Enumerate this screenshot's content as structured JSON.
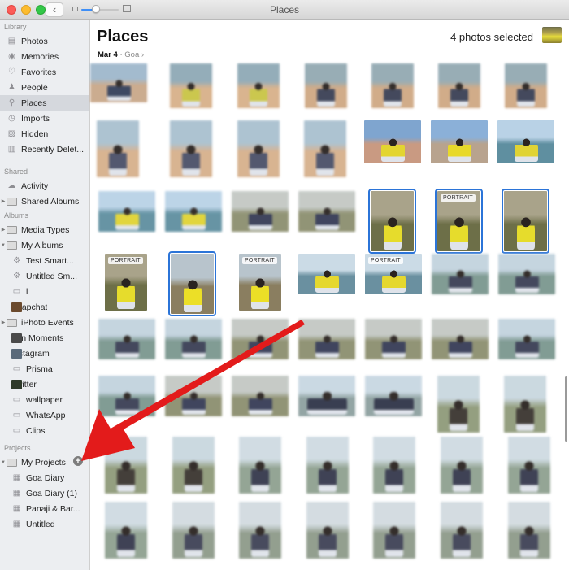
{
  "window": {
    "title": "Places",
    "back_glyph": "‹",
    "zoom_slider_value": 0.4
  },
  "sidebar": {
    "sections": [
      {
        "heading": "Library",
        "items": [
          {
            "label": "Photos",
            "icon": "photos-icon"
          },
          {
            "label": "Memories",
            "icon": "memories-icon"
          },
          {
            "label": "Favorites",
            "icon": "heart-icon"
          },
          {
            "label": "People",
            "icon": "person-icon"
          },
          {
            "label": "Places",
            "icon": "pin-icon",
            "selected": true
          },
          {
            "label": "Imports",
            "icon": "clock-icon"
          },
          {
            "label": "Hidden",
            "icon": "hidden-icon"
          },
          {
            "label": "Recently Delet...",
            "icon": "trash-icon"
          }
        ]
      },
      {
        "heading": "Shared",
        "items": [
          {
            "label": "Activity",
            "icon": "cloud-icon"
          },
          {
            "label": "Shared Albums",
            "icon": "folder-icon",
            "disclosure": "collapsed"
          }
        ]
      },
      {
        "heading": "Albums",
        "items": [
          {
            "label": "Media Types",
            "icon": "folder-icon",
            "disclosure": "collapsed"
          },
          {
            "label": "My Albums",
            "icon": "folder-icon",
            "disclosure": "expanded"
          },
          {
            "label": "Test Smart...",
            "icon": "smart-album-icon"
          },
          {
            "label": "Untitled Sm...",
            "icon": "smart-album-icon"
          },
          {
            "label": "l",
            "icon": "album-icon"
          },
          {
            "label": "Snapchat",
            "icon": "album-thumb-icon"
          },
          {
            "label": "iPhoto Events",
            "icon": "folder-icon",
            "disclosure": "collapsed"
          },
          {
            "label": "Fun Moments",
            "icon": "album-thumb-icon"
          },
          {
            "label": "Instagram",
            "icon": "album-thumb-icon"
          },
          {
            "label": "Prisma",
            "icon": "album-icon"
          },
          {
            "label": "Twitter",
            "icon": "album-thumb-icon"
          },
          {
            "label": "wallpaper",
            "icon": "album-icon"
          },
          {
            "label": "WhatsApp",
            "icon": "album-icon"
          },
          {
            "label": "Clips",
            "icon": "album-icon"
          }
        ]
      },
      {
        "heading": "Projects",
        "items": [
          {
            "label": "My Projects",
            "icon": "folder-icon",
            "disclosure": "expanded"
          },
          {
            "label": "Goa Diary",
            "icon": "project-icon"
          },
          {
            "label": "Goa Diary (1)",
            "icon": "project-icon"
          },
          {
            "label": "Panaji & Bar...",
            "icon": "project-icon"
          },
          {
            "label": "Untitled",
            "icon": "project-icon"
          }
        ]
      }
    ],
    "add_button_glyph": "+"
  },
  "main": {
    "title": "Places",
    "selected_count_label": "4 photos selected",
    "date": "Mar 4",
    "separator": "·",
    "place": "Goa",
    "place_chevron": "›",
    "portrait_badge": "PORTRAIT",
    "grid_rows": [
      [
        {
          "kind": "beach-selfie",
          "blur": true
        },
        {
          "kind": "beach-yellow",
          "blur": true
        },
        {
          "kind": "beach-yellow",
          "blur": true
        },
        {
          "kind": "beach-dark",
          "blur": true
        },
        {
          "kind": "beach-dark",
          "blur": true
        },
        {
          "kind": "beach-dark",
          "blur": true
        },
        {
          "kind": "beach-dark",
          "blur": true
        }
      ],
      [
        {
          "kind": "beach-tall",
          "blur": true
        },
        {
          "kind": "beach-tall",
          "blur": true
        },
        {
          "kind": "beach-tall",
          "blur": true
        },
        {
          "kind": "beach-tall",
          "blur": true
        },
        {
          "kind": "promenade-yellow"
        },
        {
          "kind": "selfie-yellow"
        },
        {
          "kind": "sea-yellow"
        }
      ],
      [
        {
          "kind": "sea-yellow",
          "blur": true
        },
        {
          "kind": "sea-yellow",
          "blur": true
        },
        {
          "kind": "grass-dark",
          "blur": true
        },
        {
          "kind": "grass-dark",
          "blur": true
        },
        {
          "kind": "sit-yellow",
          "selected": true
        },
        {
          "kind": "sit-yellow",
          "selected": true,
          "portrait": true
        },
        {
          "kind": "sit-yellow",
          "selected": true
        }
      ],
      [
        {
          "kind": "sit-yellow",
          "portrait": true
        },
        {
          "kind": "sit-closeup",
          "selected": true
        },
        {
          "kind": "sit-closeup",
          "portrait": true
        },
        {
          "kind": "sea-back-yellow"
        },
        {
          "kind": "sea-back-yellow",
          "portrait": true
        },
        {
          "kind": "sea-dark",
          "blur": true
        },
        {
          "kind": "sea-dark",
          "blur": true
        }
      ],
      [
        {
          "kind": "sea-dark",
          "blur": true
        },
        {
          "kind": "sea-dark",
          "blur": true
        },
        {
          "kind": "grass-dark",
          "blur": true
        },
        {
          "kind": "grass-dark",
          "blur": true
        },
        {
          "kind": "grass-dark",
          "blur": true
        },
        {
          "kind": "grass-dark",
          "blur": true
        },
        {
          "kind": "sea-dark",
          "blur": true
        }
      ],
      [
        {
          "kind": "sea-dark",
          "blur": true
        },
        {
          "kind": "grass-dark",
          "blur": true
        },
        {
          "kind": "grass-dark",
          "blur": true
        },
        {
          "kind": "group",
          "blur": true
        },
        {
          "kind": "group",
          "blur": true
        },
        {
          "kind": "statue",
          "blur": true
        },
        {
          "kind": "statue",
          "blur": true
        }
      ],
      [
        {
          "kind": "statue",
          "blur": true
        },
        {
          "kind": "statue",
          "blur": true
        },
        {
          "kind": "hill",
          "blur": true
        },
        {
          "kind": "hill",
          "blur": true
        },
        {
          "kind": "hill",
          "blur": true
        },
        {
          "kind": "hill",
          "blur": true
        },
        {
          "kind": "hill",
          "blur": true
        }
      ],
      [
        {
          "kind": "hill",
          "blur": true
        },
        {
          "kind": "tree",
          "blur": true
        },
        {
          "kind": "tree",
          "blur": true
        },
        {
          "kind": "tree",
          "blur": true
        },
        {
          "kind": "tree",
          "blur": true
        },
        {
          "kind": "tree",
          "blur": true
        },
        {
          "kind": "tree",
          "blur": true
        }
      ]
    ]
  },
  "annotation": {
    "arrow_color": "#e31b1b",
    "points_to": "add-project-button"
  },
  "colors": {
    "selection": "#2b74d8",
    "sidebar_bg": "#eceef1",
    "sidebar_selected": "#d5d8dd"
  }
}
